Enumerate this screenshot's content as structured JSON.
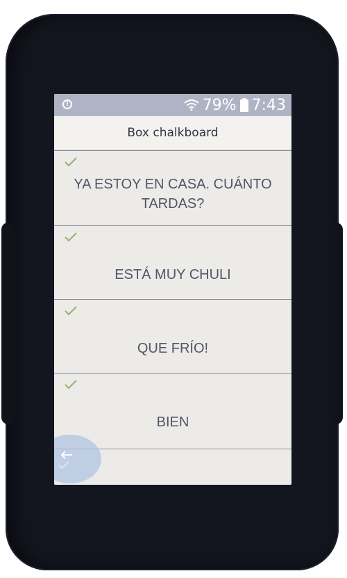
{
  "status_bar": {
    "battery_percent": "79%",
    "time": "7:43"
  },
  "header": {
    "title": "Box chalkboard"
  },
  "messages": [
    {
      "text": "YA ESTOY EN CASA. CUÁNTO TARDAS?"
    },
    {
      "text": "ESTÁ MUY CHULI"
    },
    {
      "text": "QUE FRÍO!"
    },
    {
      "text": "BIEN"
    }
  ],
  "icons": {
    "alert": "alert-circle-icon",
    "wifi": "wifi-icon",
    "battery": "battery-icon",
    "check": "check-icon",
    "back": "back-arrow-icon"
  },
  "colors": {
    "status_bar": "#aeb4c4",
    "check": "#9aae70",
    "text": "#515668",
    "back_button": "#b0c4e2"
  }
}
